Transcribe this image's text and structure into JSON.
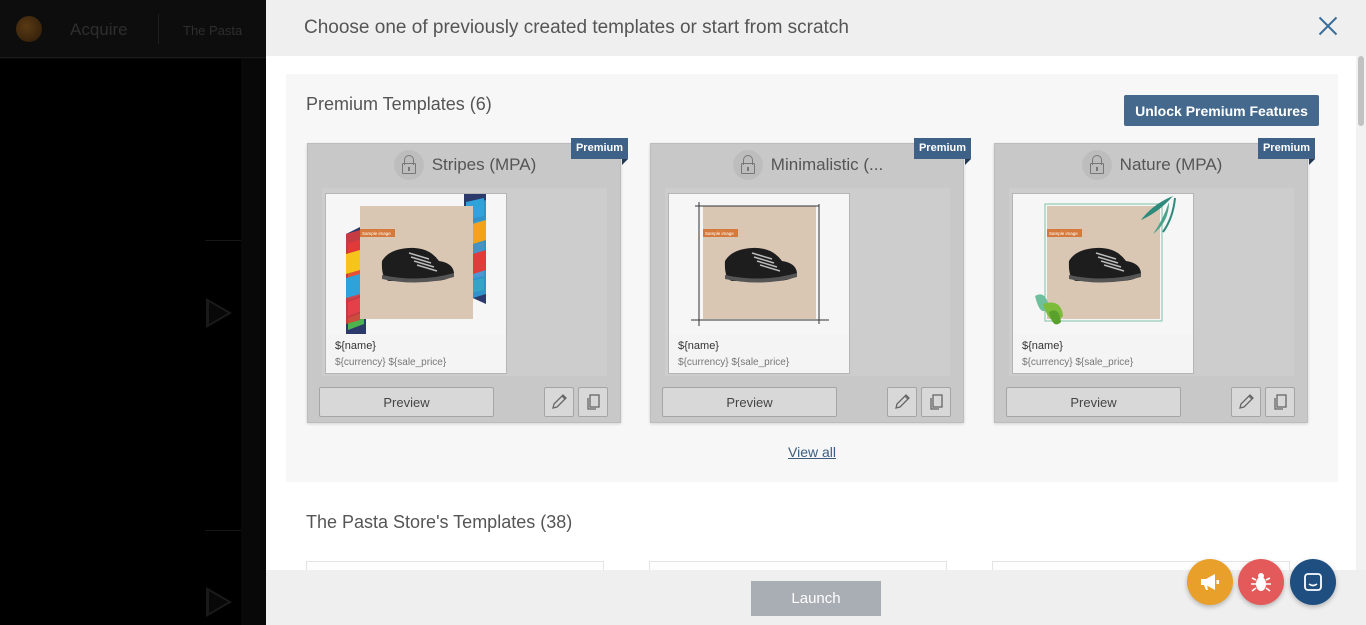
{
  "background_app": {
    "app_name": "Acquire",
    "store_name": "The Pasta"
  },
  "modal": {
    "title": "Choose one of previously created templates or start from scratch",
    "premium_section": {
      "title": "Premium Templates (6)",
      "unlock_label": "Unlock Premium Features",
      "view_all_label": "View all",
      "badge_label": "Premium",
      "cards": [
        {
          "name": "Stripes (MPA)",
          "preview_label": "Preview",
          "sample_tag": "Sample image",
          "placeholder_name": "${name}",
          "placeholder_price": "${currency} ${sale_price}"
        },
        {
          "name": "Minimalistic (...",
          "preview_label": "Preview",
          "sample_tag": "Sample image",
          "placeholder_name": "${name}",
          "placeholder_price": "${currency} ${sale_price}"
        },
        {
          "name": "Nature (MPA)",
          "preview_label": "Preview",
          "sample_tag": "Sample image",
          "placeholder_name": "${name}",
          "placeholder_price": "${currency} ${sale_price}"
        }
      ]
    },
    "store_section": {
      "title": "The Pasta Store's Templates (38)"
    },
    "footer": {
      "launch_label": "Launch"
    }
  },
  "colors": {
    "accent": "#44698c",
    "premium_badge": "#3e6287",
    "announce_fab": "#e8a02a",
    "bug_fab": "#e45a5a",
    "chat_fab": "#1e4f80",
    "launch_disabled": "#a9adb4"
  },
  "icons": [
    "close-icon",
    "lock-icon",
    "edit-icon",
    "copy-icon",
    "megaphone-icon",
    "bug-icon",
    "chat-icon"
  ]
}
